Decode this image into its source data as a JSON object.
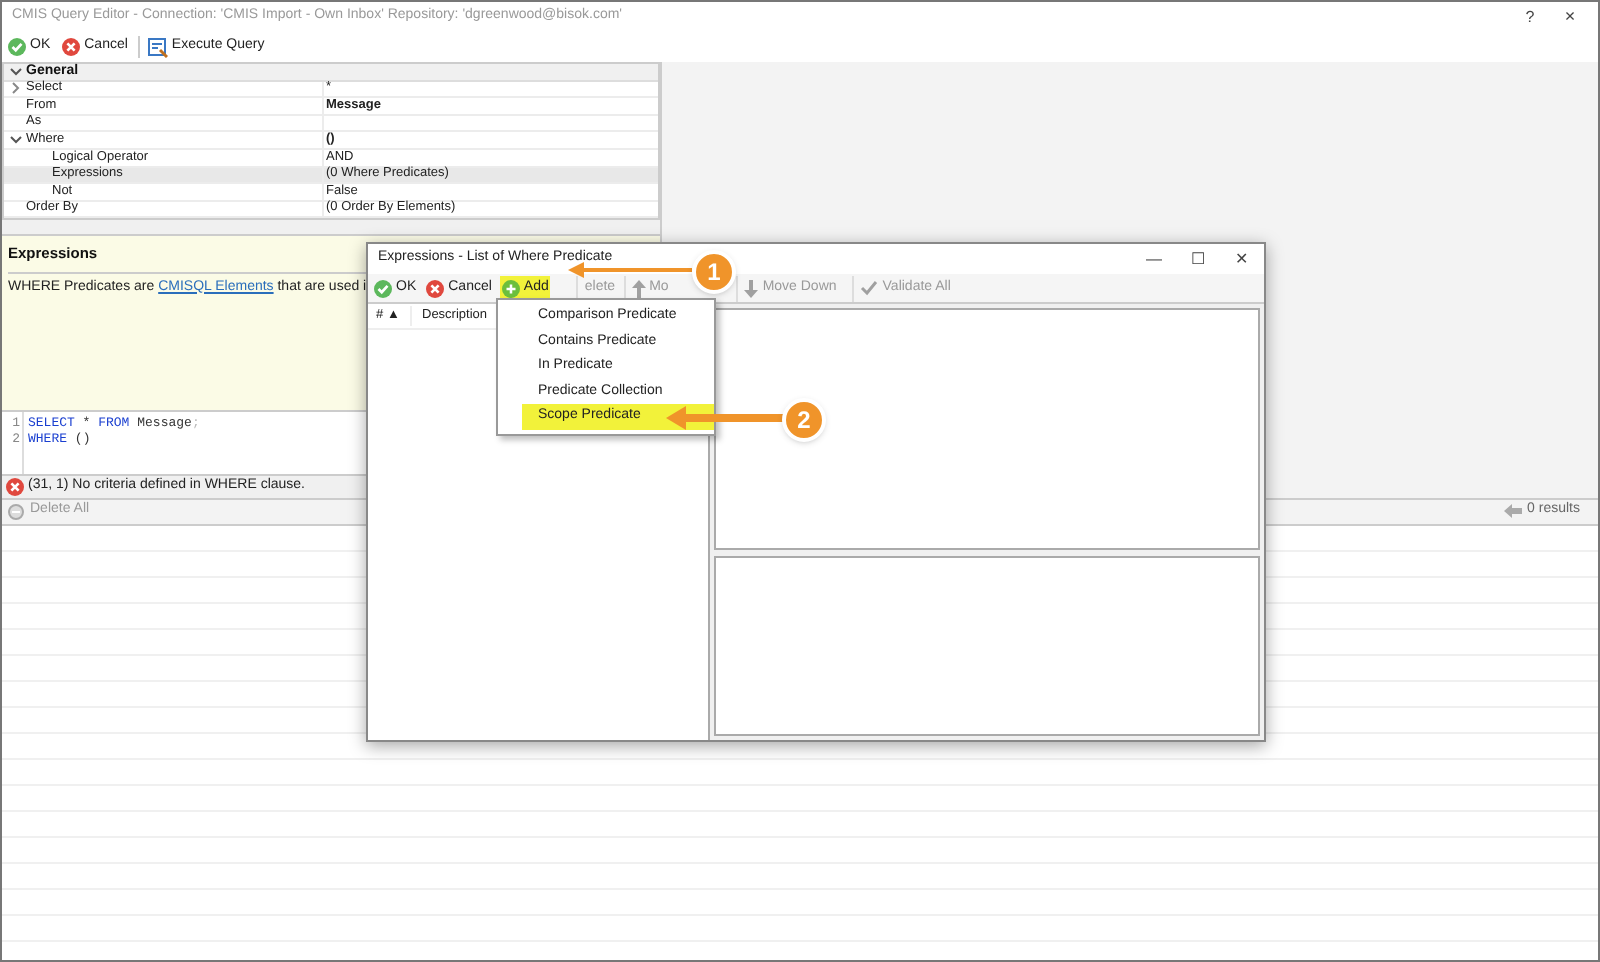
{
  "window": {
    "title": "CMIS Query Editor - Connection: 'CMIS Import - Own Inbox' Repository: 'dgreenwood@bisok.com'",
    "help": "?",
    "close": "×"
  },
  "toolbar": [
    {
      "kind": "ok",
      "label": "OK"
    },
    {
      "kind": "cancel",
      "label": "Cancel"
    },
    {
      "kind": "execute",
      "label": "Execute Query"
    }
  ],
  "property_grid": {
    "category": "General",
    "expanded": true,
    "rows": [
      {
        "name": "Select",
        "value": "*",
        "expanded": false,
        "selected": false
      },
      {
        "name": "From",
        "value": "Message",
        "bold": true,
        "selected": false
      },
      {
        "name": "As",
        "selected": false
      },
      {
        "name": "Where",
        "value": "()",
        "bold": true,
        "expanded": true,
        "selected": false,
        "children": [
          {
            "name": "Logical Operator",
            "value": "AND",
            "selected": false
          },
          {
            "name": "Expressions",
            "value": "(0 Where Predicates)",
            "selected": true
          },
          {
            "name": "Not",
            "value": "False",
            "selected": false
          }
        ]
      },
      {
        "name": "Order By",
        "value": "(0 Order By Elements)",
        "selected": false
      }
    ]
  },
  "help_panel": {
    "title": "Expressions",
    "text_before": "WHERE Predicates are ",
    "link": "CMISQL Elements",
    "text_after": " that are used i"
  },
  "code_editor": {
    "lines": [
      {
        "number": "1",
        "tokens": [
          {
            "text": "SELECT",
            "kind": "keyword"
          },
          {
            "text": " * ",
            "kind": "plain"
          },
          {
            "text": "FROM",
            "kind": "keyword"
          },
          {
            "text": " Message",
            "kind": "plain"
          },
          {
            "text": ";",
            "kind": "faint"
          }
        ]
      },
      {
        "number": "2",
        "tokens": [
          {
            "text": "WHERE",
            "kind": "keyword"
          },
          {
            "text": " ()",
            "kind": "plain"
          }
        ]
      }
    ]
  },
  "error": {
    "text": "(31, 1) No criteria defined in WHERE clause."
  },
  "results_toolbar": {
    "delete_all": "Delete All",
    "results": "0 results"
  },
  "dialog": {
    "title": "Expressions - List of Where Predicate",
    "controls": [
      "—",
      "☐",
      "✕"
    ],
    "toolbar": [
      {
        "kind": "ok",
        "label": "OK",
        "highlighted": false,
        "disabled": false
      },
      {
        "kind": "cancel",
        "label": "Cancel",
        "highlighted": false,
        "disabled": false
      },
      {
        "kind": "add",
        "label": "Add",
        "highlighted": true,
        "disabled": false
      },
      {
        "kind": "delete",
        "label": "elete",
        "highlighted": false,
        "disabled": true
      },
      {
        "kind": "moveup",
        "label": "Mo",
        "highlighted": false,
        "disabled": true
      },
      {
        "kind": "movedown",
        "label": "Move Down",
        "highlighted": false,
        "disabled": true
      },
      {
        "kind": "validate",
        "label": "Validate All",
        "highlighted": false,
        "disabled": true
      }
    ],
    "list_columns": [
      "#",
      "Description"
    ],
    "sort_indicator": "▲",
    "menu": [
      {
        "label": "Comparison Predicate",
        "highlighted": false
      },
      {
        "label": "Contains Predicate",
        "highlighted": false
      },
      {
        "label": "In Predicate",
        "highlighted": false
      },
      {
        "label": "Predicate Collection",
        "highlighted": false
      },
      {
        "label": "Scope Predicate",
        "highlighted": true
      }
    ]
  },
  "callouts": [
    {
      "number": "1"
    },
    {
      "number": "2"
    }
  ]
}
